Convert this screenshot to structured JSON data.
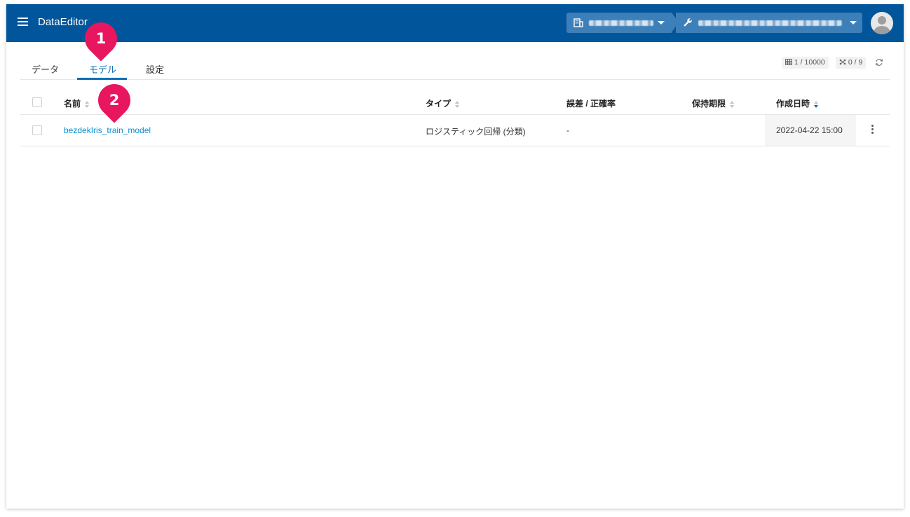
{
  "header": {
    "app_title": "DataEditor",
    "brand_color": "#00559b"
  },
  "tabs": [
    {
      "label": "データ"
    },
    {
      "label": "モデル",
      "active": true
    },
    {
      "label": "設定"
    }
  ],
  "status": {
    "rows": "1 / 10000",
    "models": "0 / 9"
  },
  "table": {
    "columns": [
      "名前",
      "タイプ",
      "誤差 / 正確率",
      "保持期限",
      "作成日時"
    ],
    "rows": [
      {
        "name": "bezdekIris_train_model",
        "type": "ロジスティック回帰 (分類)",
        "error_accuracy": "-",
        "retention": "",
        "created": "2022-04-22 15:00"
      }
    ]
  },
  "callouts": [
    "1",
    "2"
  ],
  "accent_color": "#e8165e",
  "link_color": "#0a8fd0"
}
